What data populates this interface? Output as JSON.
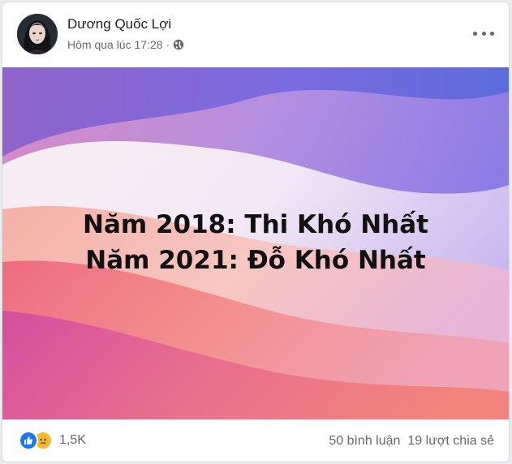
{
  "post": {
    "author": "Dương Quốc Lợi",
    "time": "Hôm qua lúc 17:28",
    "privacy_icon": "globe-icon",
    "menu_icon": "more-options-icon"
  },
  "image": {
    "line1": "Năm 2018: Thi Khó Nhất",
    "line2": "Năm 2021: Đỗ Khó Nhất"
  },
  "footer": {
    "reactions": [
      "like-icon",
      "sad-icon"
    ],
    "reaction_count": "1,5K",
    "comments": "50 bình luận",
    "shares": "19 lượt chia sẻ"
  },
  "colors": {
    "like_blue": "#1877f2",
    "sad_yellow": "#f7b928",
    "meta_gray": "#65676b"
  }
}
